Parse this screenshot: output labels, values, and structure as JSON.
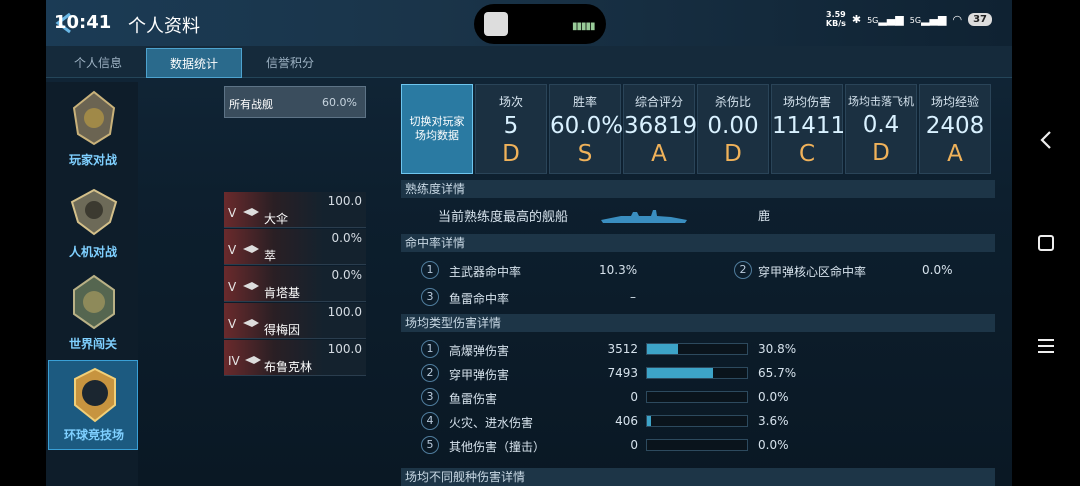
{
  "status_bar": {
    "time": "10:41",
    "speed_value": "3.59",
    "speed_unit": "KB/s",
    "signal1": "5G",
    "signal2": "5G",
    "battery": "37"
  },
  "header": {
    "title": "个人资料"
  },
  "tabs": [
    {
      "label": "个人信息"
    },
    {
      "label": "数据统计"
    },
    {
      "label": "信誉积分"
    }
  ],
  "modes": [
    {
      "label": "玩家对战"
    },
    {
      "label": "人机对战"
    },
    {
      "label": "世界闯关"
    },
    {
      "label": "环球竞技场"
    }
  ],
  "ship_filter": {
    "label": "所有战舰",
    "percent": "60.0%"
  },
  "ships": [
    {
      "tier": "V",
      "name": "大伞",
      "value": "100.0"
    },
    {
      "tier": "V",
      "name": "萃",
      "value": "0.0%"
    },
    {
      "tier": "V",
      "name": "肯塔基",
      "value": "0.0%"
    },
    {
      "tier": "V",
      "name": "得梅因",
      "value": "100.0"
    },
    {
      "tier": "IV",
      "name": "布鲁克林",
      "value": "100.0"
    }
  ],
  "switch_button": "切换对玩家场均数据",
  "stats": [
    {
      "label": "场次",
      "value": "5",
      "grade": "D"
    },
    {
      "label": "胜率",
      "value": "60.0%",
      "grade": "S"
    },
    {
      "label": "综合评分",
      "value": "36819",
      "grade": "A"
    },
    {
      "label": "杀伤比",
      "value": "0.00",
      "grade": "D"
    },
    {
      "label": "场均伤害",
      "value": "11411",
      "grade": "C"
    },
    {
      "label": "场均击落飞机",
      "value": "0.4",
      "grade": "D"
    },
    {
      "label": "场均经验",
      "value": "2408",
      "grade": "A"
    }
  ],
  "proficiency": {
    "header": "熟练度详情",
    "label": "当前熟练度最高的舰船",
    "ship": "鹿"
  },
  "hit_rate": {
    "header": "命中率详情",
    "items": [
      {
        "n": "1",
        "label": "主武器命中率",
        "value": "10.3%"
      },
      {
        "n": "2",
        "label": "穿甲弹核心区命中率",
        "value": "0.0%"
      },
      {
        "n": "3",
        "label": "鱼雷命中率",
        "value": "–"
      }
    ]
  },
  "damage": {
    "header": "场均类型伤害详情",
    "items": [
      {
        "n": "1",
        "label": "高爆弹伤害",
        "value": "3512",
        "percent": "30.8%",
        "ratio": 0.308
      },
      {
        "n": "2",
        "label": "穿甲弹伤害",
        "value": "7493",
        "percent": "65.7%",
        "ratio": 0.657
      },
      {
        "n": "3",
        "label": "鱼雷伤害",
        "value": "0",
        "percent": "0.0%",
        "ratio": 0.0
      },
      {
        "n": "4",
        "label": "火灾、进水伤害",
        "value": "406",
        "percent": "3.6%",
        "ratio": 0.036
      },
      {
        "n": "5",
        "label": "其他伤害（撞击）",
        "value": "0",
        "percent": "0.0%",
        "ratio": 0.0
      }
    ]
  },
  "ship_type_damage": {
    "header": "场均不同舰种伤害详情"
  },
  "colors": {
    "accent": "#2a7aa2",
    "grade": "#f0b25a",
    "bar": "#3da4c8"
  },
  "nav_icons": [
    "back-icon",
    "home-icon",
    "menu-icon"
  ]
}
